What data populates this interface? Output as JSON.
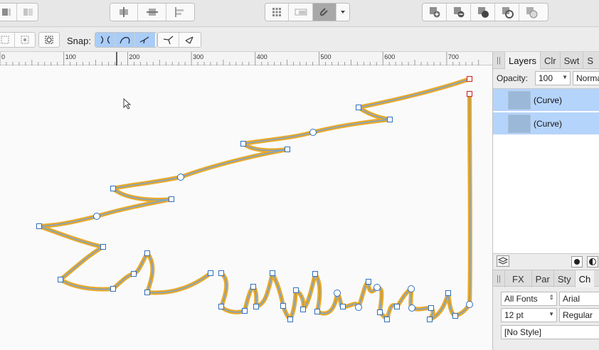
{
  "toolbar": {
    "groups": [
      {
        "name": "arrange-group",
        "buttons": [
          "arrange-icon",
          "arrange-alt-icon"
        ]
      },
      {
        "name": "align-group",
        "buttons": [
          "align-center-icon",
          "align-middle-icon",
          "align-left-icon"
        ]
      },
      {
        "name": "view-group",
        "buttons": [
          "grid-icon",
          "view-mode-icon",
          "snapping-magnet-icon",
          "chevron-down-icon"
        ]
      },
      {
        "name": "boolean-group",
        "buttons": [
          "add-icon",
          "subtract-icon",
          "intersect-icon",
          "divide-icon",
          "combine-icon"
        ]
      }
    ]
  },
  "context": {
    "snap_label": "Snap:",
    "snap_buttons": [
      "snap-nodes-icon",
      "snap-curves-icon",
      "snap-handles-icon"
    ],
    "node_buttons": [
      "node-sharp-icon",
      "node-smooth-icon"
    ]
  },
  "ruler": {
    "labels": [
      "0",
      "100",
      "200",
      "300",
      "400",
      "500",
      "600",
      "700"
    ]
  },
  "layers_panel": {
    "tabs": [
      "Layers",
      "Clr",
      "Swt",
      "S"
    ],
    "opacity_label": "Opacity:",
    "opacity_value": "100",
    "blend_mode": "Norma",
    "layers": [
      {
        "name": "(Curve)"
      },
      {
        "name": "(Curve)"
      }
    ]
  },
  "text_panel": {
    "tabs": [
      "FX",
      "Par",
      "Sty",
      "Ch"
    ],
    "font_collection": "All Fonts",
    "font_family": "Arial",
    "font_size": "12 pt",
    "font_style": "Regular",
    "paragraph_style": "[No Style]"
  },
  "colors": {
    "curve_outer": "#e7a92b",
    "curve_inner": "#7aa2cf",
    "node_stroke": "#2f6fbf",
    "selected_node": "#d03030",
    "layer_selected": "#b5d4fb",
    "snap_active": "#a9cdf7"
  }
}
